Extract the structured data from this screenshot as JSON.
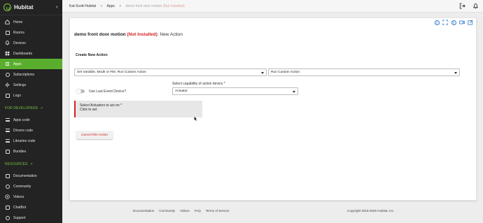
{
  "app": {
    "name": "Hubitat"
  },
  "sidebar": {
    "items": [
      {
        "label": "Home",
        "icon": "home-icon"
      },
      {
        "label": "Rooms",
        "icon": "rooms-icon"
      },
      {
        "label": "Devices",
        "icon": "devices-icon"
      },
      {
        "label": "Dashboards",
        "icon": "dashboards-icon"
      },
      {
        "label": "Apps",
        "icon": "apps-icon",
        "active": true
      },
      {
        "label": "Subscriptions",
        "icon": "subscriptions-icon"
      },
      {
        "label": "Settings",
        "icon": "settings-icon"
      },
      {
        "label": "Logs",
        "icon": "logs-icon"
      }
    ],
    "developers_label": "FOR DEVELOPERS",
    "developer_items": [
      {
        "label": "Apps code"
      },
      {
        "label": "Drivers code"
      },
      {
        "label": "Libraries code"
      },
      {
        "label": "Bundles"
      }
    ],
    "resources_label": "RESOURCES",
    "resource_items": [
      {
        "label": "Documentation"
      },
      {
        "label": "Community"
      },
      {
        "label": "Videos"
      },
      {
        "label": "ChatBot"
      },
      {
        "label": "Support"
      }
    ]
  },
  "breadcrumb": {
    "hub": "Kat-Scott-Hubitat",
    "section": "Apps",
    "current": "demo front door motion",
    "current_status": "(Not Installed)"
  },
  "page": {
    "title": "demo front door motion",
    "status": "(Not Installed)",
    "subtitle": ": New Action",
    "section_heading": "Create New Action",
    "action_type_select": "Set Variable, Mode or File, Run Custom Action",
    "action_select": "Run Custom Action",
    "use_last_event_label": "Use Last Event Device?",
    "capability_label": "Select capability of action device *",
    "capability_select": "Actuator",
    "select_actuators_line1": "Select Actuators to act on *",
    "select_actuators_line2": "Click to set",
    "cancel_button": "Cancel this Action"
  },
  "footer": {
    "links": [
      "Documentation",
      "Community",
      "Videos",
      "FAQ",
      "Terms of Service"
    ],
    "copyright": "Copyright 2018-2025 Hubitat, Inc."
  },
  "colors": {
    "sidebar_bg": "#232323",
    "accent_green": "#5aae2d",
    "not_installed_red": "#d32222",
    "icon_blue": "#2a78c8"
  }
}
